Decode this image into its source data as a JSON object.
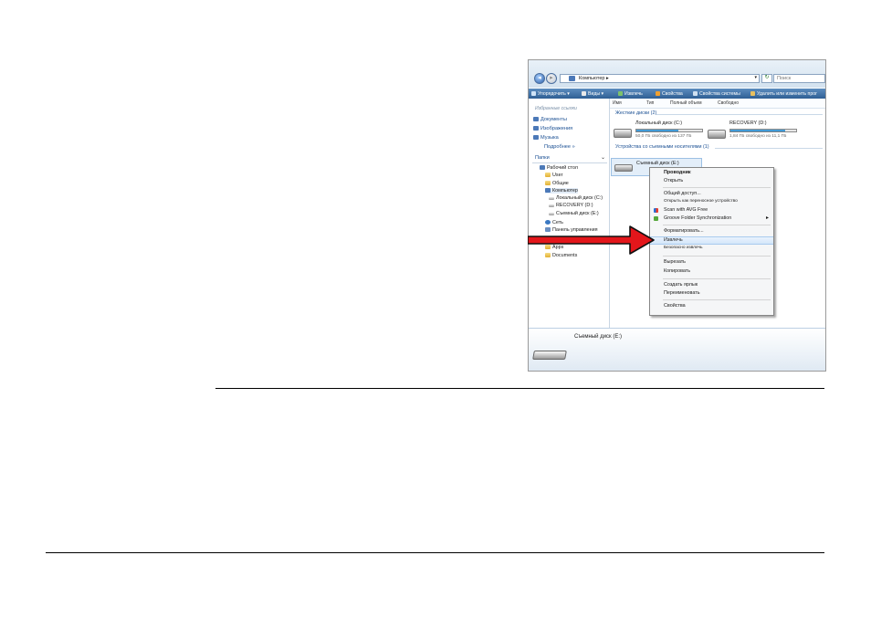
{
  "address_bar": {
    "path": "Компьютер ▸",
    "search_placeholder": "Поиск"
  },
  "toolbar": {
    "items": [
      "Упорядочить ▾",
      "Виды ▾",
      "Извлечь",
      "Свойства",
      "Свойства системы",
      "Удалить или изменить прог"
    ]
  },
  "nav": {
    "favorites_header": "Избранные ссылки",
    "favorites": [
      "Документы",
      "Изображения",
      "Музыка"
    ],
    "more": "Подробнее »",
    "folders_label": "Папки",
    "folders_chevron": "⌄",
    "tree": [
      "Рабочий стол",
      "User",
      "Общие",
      "Компьютер",
      "Локальный диск (C:)",
      "RECOVERY (D:)",
      "Съемный диск (E:)",
      "Сеть",
      "Панель управления",
      "Apps",
      "Documents"
    ]
  },
  "columns": [
    "Имя",
    "Тип",
    "Полный объем",
    "Свободно"
  ],
  "hard_drives": {
    "group_label": "Жесткие диски (2)",
    "drives": [
      {
        "name": "Локальный диск (C:)",
        "free_text": "50,0 ГБ свободно из 137 ГБ",
        "used_fraction": 0.64
      },
      {
        "name": "RECOVERY (D:)",
        "free_text": "1,84 ГБ свободно из 11,1 ГБ",
        "used_fraction": 0.83
      }
    ]
  },
  "removable": {
    "group_label": "Устройства со съемными носителями (1)",
    "drive_name": "Съемный диск (E:)"
  },
  "context_menu": {
    "items": [
      {
        "label": "Проводник",
        "bold": true
      },
      {
        "label": "Открыть"
      },
      {
        "label": "Общий доступ..."
      },
      {
        "label": "Открыть как переносное устройство"
      },
      {
        "label": "Scan with AVG Free",
        "icon": "avg-icon"
      },
      {
        "label": "Groove Folder Synchronization",
        "icon": "groove-icon",
        "submenu": true
      },
      {
        "label": "Форматировать..."
      },
      {
        "label": "Извлечь",
        "highlighted": true
      },
      {
        "label": "Безопасно извлечь"
      },
      {
        "label": "Вырезать"
      },
      {
        "label": "Копировать"
      },
      {
        "label": "Создать ярлык"
      },
      {
        "label": "Переименовать"
      },
      {
        "label": "Свойства"
      }
    ],
    "submenu_glyph": "▸"
  },
  "details": {
    "name": "Съемный диск (E:)"
  },
  "colors": {
    "toolbar": "#2f5f94",
    "arrow_fill": "#e3161b",
    "highlight": "#d3e6fa",
    "link": "#1a4f93"
  }
}
